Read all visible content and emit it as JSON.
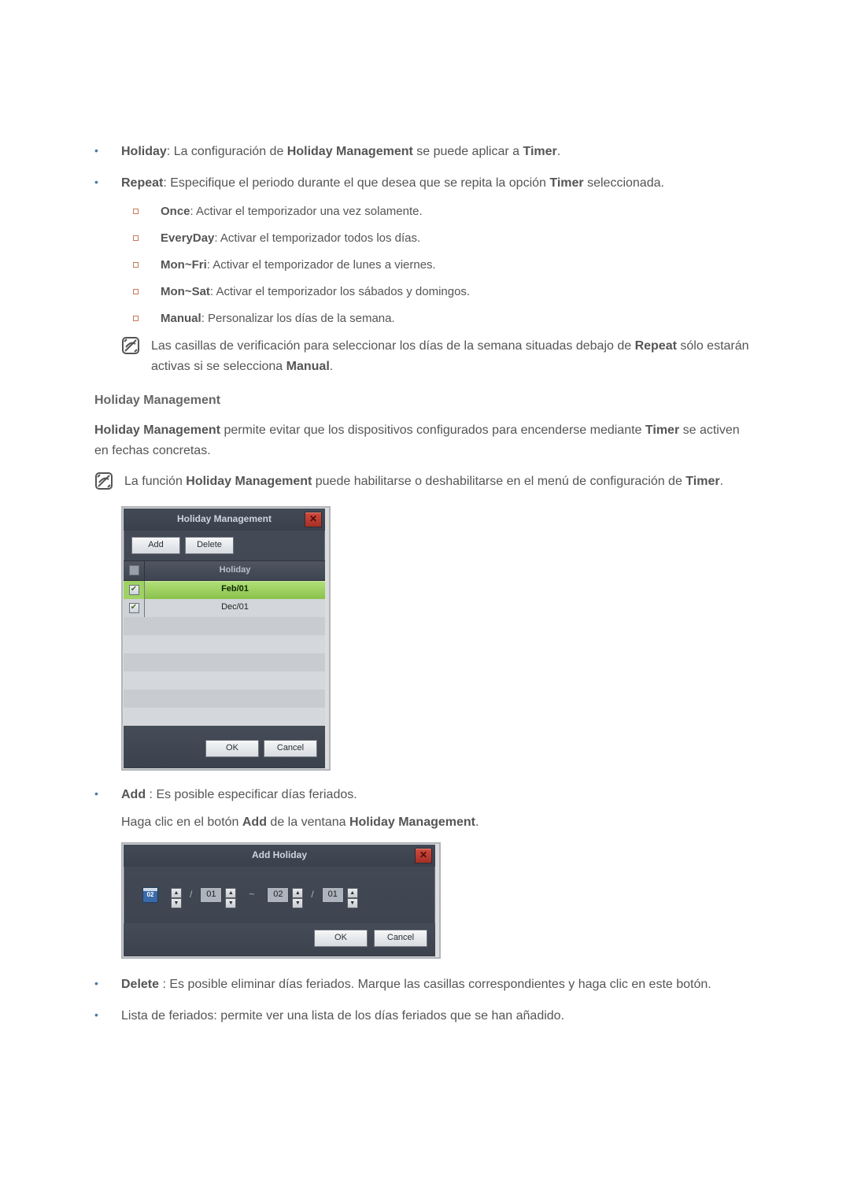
{
  "bullets": {
    "holiday": {
      "label": "Holiday",
      "text": ": La configuración de ",
      "emph1": "Holiday Management",
      "text2": " se puede aplicar a ",
      "emph2": "Timer",
      "tail": "."
    },
    "repeat": {
      "label": "Repeat",
      "text": ": Especifique el periodo durante el que desea que se repita la opción ",
      "emph1": "Timer",
      "tail": " seleccionada."
    },
    "sub": {
      "once": {
        "label": "Once",
        "text": ": Activar el temporizador una vez solamente."
      },
      "everyday": {
        "label": "EveryDay",
        "text": ": Activar el temporizador todos los días."
      },
      "monfri": {
        "label": "Mon~Fri",
        "text": ": Activar el temporizador de lunes a viernes."
      },
      "monsat": {
        "label": "Mon~Sat",
        "text": ": Activar el temporizador los sábados y domingos."
      },
      "manual": {
        "label": "Manual",
        "text": ": Personalizar los días de la semana."
      }
    },
    "add": {
      "label": "Add ",
      "text": ": Es posible especificar días feriados.",
      "line2_a": "Haga clic en el botón ",
      "line2_b": "Add",
      "line2_c": " de la ventana ",
      "line2_d": "Holiday Management",
      "line2_e": "."
    },
    "delete": {
      "label": "Delete ",
      "text": ": Es posible eliminar días feriados. Marque las casillas correspondientes y haga clic en este botón."
    },
    "list": {
      "text": "Lista de feriados: permite ver una lista de los días feriados que se han añadido."
    }
  },
  "notes": {
    "n1": {
      "a": "Las casillas de verificación para seleccionar los días de la semana situadas debajo de ",
      "b": "Repeat",
      "c": " sólo estarán activas si se selecciona ",
      "d": "Manual",
      "e": "."
    },
    "n2": {
      "a": "La función ",
      "b": "Holiday Management",
      "c": " puede habilitarse o deshabilitarse en el menú de configuración de ",
      "d": "Timer",
      "e": "."
    }
  },
  "section": {
    "hm_title": "Holiday Management",
    "hm_para_a": "Holiday Management",
    "hm_para_b": " permite evitar que los dispositivos configurados para encenderse mediante ",
    "hm_para_c": "Timer",
    "hm_para_d": " se activen en fechas concretas."
  },
  "hm": {
    "title": "Holiday Management",
    "toolbar": {
      "add": "Add",
      "delete": "Delete"
    },
    "header": "Holiday",
    "rows": [
      {
        "date": "Feb/01",
        "checked": true,
        "selected": true
      },
      {
        "date": "Dec/01",
        "checked": true,
        "selected": false
      }
    ],
    "footer": {
      "ok": "OK",
      "cancel": "Cancel"
    }
  },
  "ah": {
    "title": "Add Holiday",
    "m1": "02",
    "d1": "01",
    "m2": "02",
    "d2": "01",
    "cal_label": "02",
    "footer": {
      "ok": "OK",
      "cancel": "Cancel"
    }
  }
}
